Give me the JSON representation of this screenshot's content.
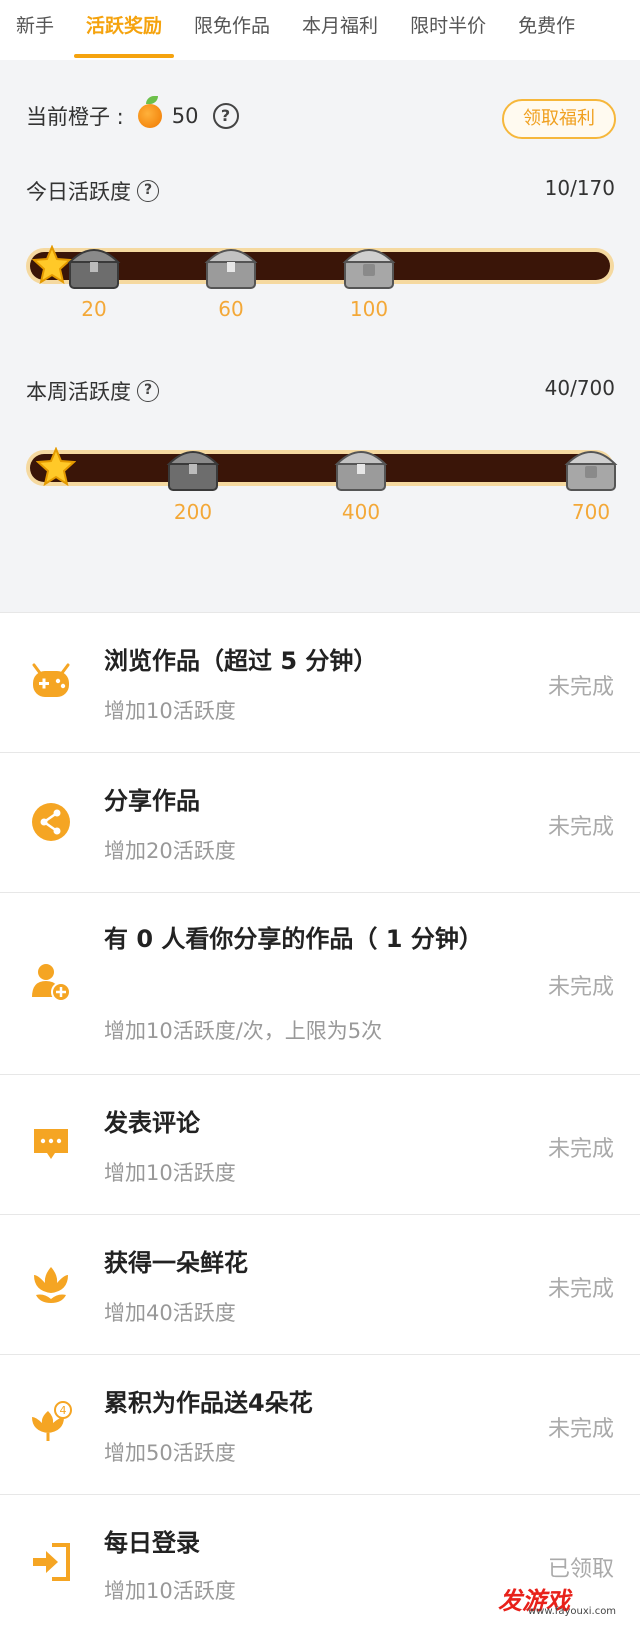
{
  "tabs": [
    "新手",
    "活跃奖励",
    "限免作品",
    "本月福利",
    "限时半价",
    "免费作"
  ],
  "orange": {
    "label": "当前橙子 :",
    "count": "50",
    "help": "?"
  },
  "claim_button": "领取福利",
  "daily": {
    "label": "今日活跃度",
    "help": "?",
    "current": "10/170",
    "milestones": [
      "20",
      "60",
      "100"
    ],
    "progress": 10,
    "max": 170
  },
  "weekly": {
    "label": "本周活跃度",
    "help": "?",
    "current": "40/700",
    "milestones": [
      "200",
      "400",
      "700"
    ],
    "progress": 40,
    "max": 700
  },
  "tasks": [
    {
      "title": "浏览作品（超过 5 分钟）",
      "sub": "增加10活跃度",
      "status": "未完成",
      "icon": "gamepad-icon"
    },
    {
      "title": "分享作品",
      "sub": "增加20活跃度",
      "status": "未完成",
      "icon": "share-icon"
    },
    {
      "title": "有 0 人看你分享的作品（ 1 分钟）",
      "sub": "增加10活跃度/次，上限为5次",
      "status": "未完成",
      "icon": "add-user-icon"
    },
    {
      "title": "发表评论",
      "sub": "增加10活跃度",
      "status": "未完成",
      "icon": "comment-icon"
    },
    {
      "title": "获得一朵鲜花",
      "sub": "增加40活跃度",
      "status": "未完成",
      "icon": "flower-icon"
    },
    {
      "title": "累积为作品送4朵花",
      "sub": "增加50活跃度",
      "status": "未完成",
      "icon": "flower-badge-icon",
      "badge": "4"
    },
    {
      "title": "每日登录",
      "sub": "增加10活跃度",
      "status": "已领取",
      "icon": "login-icon"
    }
  ],
  "watermark": {
    "main": "发游戏",
    "sub": "www.fayouxi.com"
  },
  "colors": {
    "accent": "#f5a30e",
    "track": "#3a1508",
    "milestone": "#f3a838"
  }
}
